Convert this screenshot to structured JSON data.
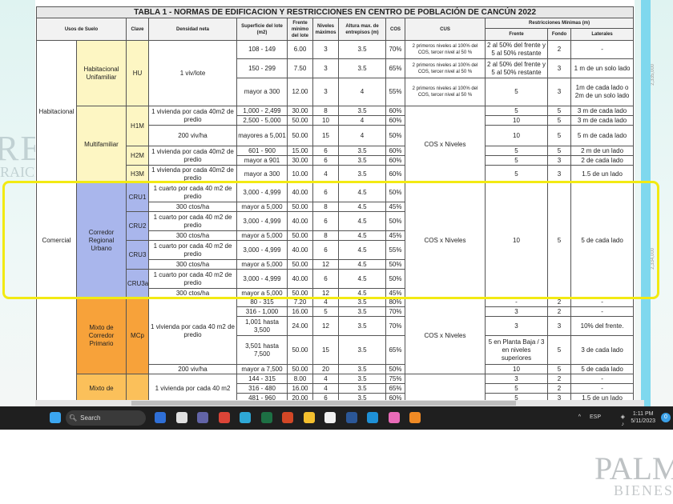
{
  "watermarks": {
    "left": "REAL",
    "left_sub": "RAICES",
    "bottom": "PALMA",
    "bottom_sub": "BIENES"
  },
  "ruler": {
    "a": "2,335,000",
    "b": "2,334,000"
  },
  "table": {
    "title": "TABLA 1 - NORMAS DE EDIFICACION Y RESTRICCIONES EN CENTRO DE POBLACIÓN DE CANCÚN 2022",
    "header1": [
      {
        "t": "Usos de Suelo",
        "rs": 2,
        "cs": 2
      },
      {
        "t": "Clave",
        "rs": 2
      },
      {
        "t": "Densidad neta",
        "rs": 2
      },
      {
        "t": "Superficie del lote (m2)",
        "rs": 2
      },
      {
        "t": "Frente mínimo del lote",
        "rs": 2
      },
      {
        "t": "Niveles máximos",
        "rs": 2
      },
      {
        "t": "Altura max. de entrepisos (m)",
        "rs": 2
      },
      {
        "t": "COS",
        "rs": 2
      },
      {
        "t": "CUS",
        "rs": 2
      },
      {
        "t": "Restricciones Mínimas (m)",
        "cs": 3
      }
    ],
    "header2": [
      {
        "t": "Frente"
      },
      {
        "t": "Fondo"
      },
      {
        "t": "Laterales"
      }
    ],
    "rows": [
      [
        {
          "t": "Habitacional",
          "rs": 9
        },
        {
          "t": "Habitacional Unifamiliar",
          "rs": 3,
          "bg": "#fdf6c3"
        },
        {
          "t": "HU",
          "rs": 3,
          "bg": "#fdf6c3"
        },
        {
          "t": "1 viv/lote",
          "rs": 3
        },
        {
          "t": "108 - 149"
        },
        {
          "t": "6.00"
        },
        {
          "t": "3"
        },
        {
          "t": "3.5"
        },
        {
          "t": "70%"
        },
        {
          "t": "2 primeros niveles al 100% del COS, tercer nivel al 50 %",
          "small": 1
        },
        {
          "t": "2 al 50% del frente y 5 al 50% restante"
        },
        {
          "t": "2"
        },
        {
          "t": "-"
        }
      ],
      [
        {
          "t": "150 - 299"
        },
        {
          "t": "7.50"
        },
        {
          "t": "3"
        },
        {
          "t": "3.5"
        },
        {
          "t": "65%"
        },
        {
          "t": "2 primeros niveles al 100% del COS, tercer nivel al 50 %",
          "small": 1
        },
        {
          "t": "2 al 50% del frente y 5 al 50% restante"
        },
        {
          "t": "3"
        },
        {
          "t": "1 m de un solo lado"
        }
      ],
      [
        {
          "t": "mayor a 300"
        },
        {
          "t": "12.00"
        },
        {
          "t": "3"
        },
        {
          "t": "4"
        },
        {
          "t": "55%"
        },
        {
          "t": "2 primeros niveles al 100% del COS, tercer nivel al 50 %",
          "small": 1
        },
        {
          "t": "5"
        },
        {
          "t": "3"
        },
        {
          "t": "1m de cada lado o 2m de un solo lado"
        }
      ],
      [
        {
          "t": "Multifamiliar",
          "rs": 6,
          "bg": "#fdf6c3"
        },
        {
          "t": "H1M",
          "rs": 3,
          "bg": "#fdf6c3"
        },
        {
          "t": "1 vivienda por cada 40m2 de predio",
          "rs": 2
        },
        {
          "t": "1,000 - 2,499"
        },
        {
          "t": "30.00"
        },
        {
          "t": "8"
        },
        {
          "t": "3.5"
        },
        {
          "t": "60%"
        },
        {
          "t": "COS x Niveles",
          "rs": 6
        },
        {
          "t": "5"
        },
        {
          "t": "5"
        },
        {
          "t": "3 m de cada lado"
        }
      ],
      [
        {
          "t": "2,500 - 5,000"
        },
        {
          "t": "50.00"
        },
        {
          "t": "10"
        },
        {
          "t": "4"
        },
        {
          "t": "60%"
        },
        {
          "t": "10"
        },
        {
          "t": "5"
        },
        {
          "t": "3 m de cada lado"
        }
      ],
      [
        {
          "t": "200 viv/ha"
        },
        {
          "t": "mayores a 5,001"
        },
        {
          "t": "50.00"
        },
        {
          "t": "15"
        },
        {
          "t": "4"
        },
        {
          "t": "50%"
        },
        {
          "t": "10"
        },
        {
          "t": "5"
        },
        {
          "t": "5 m de cada lado"
        }
      ],
      [
        {
          "t": "H2M",
          "rs": 2,
          "bg": "#fdf6c3"
        },
        {
          "t": "1 vivienda por cada 40m2 de predio",
          "rs": 2
        },
        {
          "t": "601 - 900"
        },
        {
          "t": "15.00"
        },
        {
          "t": "6"
        },
        {
          "t": "3.5"
        },
        {
          "t": "60%"
        },
        {
          "t": "5"
        },
        {
          "t": "5"
        },
        {
          "t": "2 m de un lado"
        }
      ],
      [
        {
          "t": "mayor a 901"
        },
        {
          "t": "30.00"
        },
        {
          "t": "6"
        },
        {
          "t": "3.5"
        },
        {
          "t": "60%"
        },
        {
          "t": "5"
        },
        {
          "t": "3"
        },
        {
          "t": "2 de cada lado"
        }
      ],
      [
        {
          "t": "H3M",
          "bg": "#fdf6c3"
        },
        {
          "t": "1 vivienda por cada 40m2 de predio"
        },
        {
          "t": "mayor a 300"
        },
        {
          "t": "10.00"
        },
        {
          "t": "4"
        },
        {
          "t": "3.5"
        },
        {
          "t": "60%"
        },
        {
          "t": "5"
        },
        {
          "t": "3"
        },
        {
          "t": "1.5 de un lado"
        }
      ],
      [
        {
          "t": "Comercial",
          "rs": 8
        },
        {
          "t": "Corredor Regional Urbano",
          "rs": 8,
          "bg": "#a9b6ec"
        },
        {
          "t": "CRU1",
          "rs": 2,
          "bg": "#a9b6ec"
        },
        {
          "t": "1 cuarto por cada 40 m2 de predio"
        },
        {
          "t": "3,000 - 4,999"
        },
        {
          "t": "40.00"
        },
        {
          "t": "6"
        },
        {
          "t": "4.5"
        },
        {
          "t": "50%"
        },
        {
          "t": "COS x Niveles",
          "rs": 8
        },
        {
          "t": "10",
          "rs": 8
        },
        {
          "t": "5",
          "rs": 8
        },
        {
          "t": "5 de cada lado",
          "rs": 8
        }
      ],
      [
        {
          "t": "300 ctos/ha"
        },
        {
          "t": "mayor a 5,000"
        },
        {
          "t": "50.00"
        },
        {
          "t": "8"
        },
        {
          "t": "4.5"
        },
        {
          "t": "45%"
        }
      ],
      [
        {
          "t": "CRU2",
          "rs": 2,
          "bg": "#a9b6ec"
        },
        {
          "t": "1 cuarto por cada 40 m2 de predio"
        },
        {
          "t": "3,000 - 4,999"
        },
        {
          "t": "40.00"
        },
        {
          "t": "6"
        },
        {
          "t": "4.5"
        },
        {
          "t": "50%"
        }
      ],
      [
        {
          "t": "300 ctos/ha"
        },
        {
          "t": "mayor a 5,000"
        },
        {
          "t": "50.00"
        },
        {
          "t": "8"
        },
        {
          "t": "4.5"
        },
        {
          "t": "45%"
        }
      ],
      [
        {
          "t": "CRU3",
          "rs": 2,
          "bg": "#a9b6ec"
        },
        {
          "t": "1 cuarto por cada 40 m2 de predio"
        },
        {
          "t": "3,000 - 4,999"
        },
        {
          "t": "40.00"
        },
        {
          "t": "6"
        },
        {
          "t": "4.5"
        },
        {
          "t": "55%"
        }
      ],
      [
        {
          "t": "300 ctos/ha"
        },
        {
          "t": "mayor a 5,000"
        },
        {
          "t": "50.00"
        },
        {
          "t": "12"
        },
        {
          "t": "4.5"
        },
        {
          "t": "50%"
        }
      ],
      [
        {
          "t": "CRU3a",
          "rs": 2,
          "bg": "#a9b6ec"
        },
        {
          "t": "1 cuarto por cada 40 m2 de predio"
        },
        {
          "t": "3,000 - 4,999"
        },
        {
          "t": "40.00"
        },
        {
          "t": "6"
        },
        {
          "t": "4.5"
        },
        {
          "t": "50%"
        }
      ],
      [
        {
          "t": "300 ctos/ha"
        },
        {
          "t": "mayor a 5,000"
        },
        {
          "t": "50.00"
        },
        {
          "t": "12"
        },
        {
          "t": "4.5"
        },
        {
          "t": "45%"
        }
      ],
      [
        {
          "t": "",
          "rs": 8
        },
        {
          "t": "Mixto de Corredor Primario",
          "rs": 5,
          "bg": "#f7a23a"
        },
        {
          "t": "MCp",
          "rs": 5,
          "bg": "#f7a23a"
        },
        {
          "t": "1 vivienda por cada 40 m2 de predio",
          "rs": 4
        },
        {
          "t": "80 - 315"
        },
        {
          "t": "7.20"
        },
        {
          "t": "4"
        },
        {
          "t": "3.5"
        },
        {
          "t": "80%"
        },
        {
          "t": "COS x Niveles",
          "rs": 5
        },
        {
          "t": "-"
        },
        {
          "t": "2"
        },
        {
          "t": "-"
        }
      ],
      [
        {
          "t": "316 - 1,000"
        },
        {
          "t": "16.00"
        },
        {
          "t": "5"
        },
        {
          "t": "3.5"
        },
        {
          "t": "70%"
        },
        {
          "t": "3"
        },
        {
          "t": "2"
        },
        {
          "t": "-"
        }
      ],
      [
        {
          "t": "1,001 hasta 3,500"
        },
        {
          "t": "24.00"
        },
        {
          "t": "12"
        },
        {
          "t": "3.5"
        },
        {
          "t": "70%"
        },
        {
          "t": "3"
        },
        {
          "t": "3"
        },
        {
          "t": "10% del frente."
        }
      ],
      [
        {
          "t": "3,501 hasta 7,500"
        },
        {
          "t": "50.00"
        },
        {
          "t": "15"
        },
        {
          "t": "3.5"
        },
        {
          "t": "65%"
        },
        {
          "t": "5 en Planta Baja / 3 en niveles superiores"
        },
        {
          "t": "5"
        },
        {
          "t": "3 de cada lado"
        }
      ],
      [
        {
          "t": "200 viv/ha"
        },
        {
          "t": "mayor a 7,500"
        },
        {
          "t": "50.00"
        },
        {
          "t": "20"
        },
        {
          "t": "3.5"
        },
        {
          "t": "50%"
        },
        {
          "t": "10"
        },
        {
          "t": "5"
        },
        {
          "t": "5 de cada lado"
        }
      ],
      [
        {
          "t": "Mixto de",
          "rs": 3,
          "bg": "#fbc05a"
        },
        {
          "t": "",
          "rs": 3,
          "bg": "#fbc05a"
        },
        {
          "t": "1 vivienda por cada 40 m2",
          "rs": 3
        },
        {
          "t": "144 - 315"
        },
        {
          "t": "8.00"
        },
        {
          "t": "4"
        },
        {
          "t": "3.5"
        },
        {
          "t": "75%"
        },
        {
          "t": "",
          "rs": 3
        },
        {
          "t": "3"
        },
        {
          "t": "2"
        },
        {
          "t": "-"
        }
      ],
      [
        {
          "t": "316 - 480"
        },
        {
          "t": "16.00"
        },
        {
          "t": "4"
        },
        {
          "t": "3.5"
        },
        {
          "t": "65%"
        },
        {
          "t": "5"
        },
        {
          "t": "2"
        },
        {
          "t": "-"
        }
      ],
      [
        {
          "t": "481 - 960"
        },
        {
          "t": "20.00"
        },
        {
          "t": "6"
        },
        {
          "t": "3.5"
        },
        {
          "t": "60%"
        },
        {
          "t": "5"
        },
        {
          "t": "3"
        },
        {
          "t": "1.5 de un lado"
        }
      ]
    ]
  },
  "taskbar": {
    "search_label": "Search",
    "apps": [
      {
        "name": "bing",
        "color": "#2f6fd6"
      },
      {
        "name": "task-view",
        "color": "#e0e0e0"
      },
      {
        "name": "teams",
        "color": "#6264a7"
      },
      {
        "name": "chrome",
        "color": "#db4437"
      },
      {
        "name": "edge",
        "color": "#2ea8d6"
      },
      {
        "name": "excel",
        "color": "#1d7044"
      },
      {
        "name": "powerpoint",
        "color": "#d24726"
      },
      {
        "name": "file-explorer",
        "color": "#f4c02e"
      },
      {
        "name": "notepad",
        "color": "#f0f0f0"
      },
      {
        "name": "word",
        "color": "#2b5797"
      },
      {
        "name": "mail",
        "color": "#1e90d6"
      },
      {
        "name": "itunes",
        "color": "#e96bb8"
      },
      {
        "name": "acrobat",
        "color": "#f08a24"
      }
    ],
    "lang": "ESP",
    "time": "1:11 PM",
    "date": "5/11/2023",
    "notif_count": "0"
  }
}
